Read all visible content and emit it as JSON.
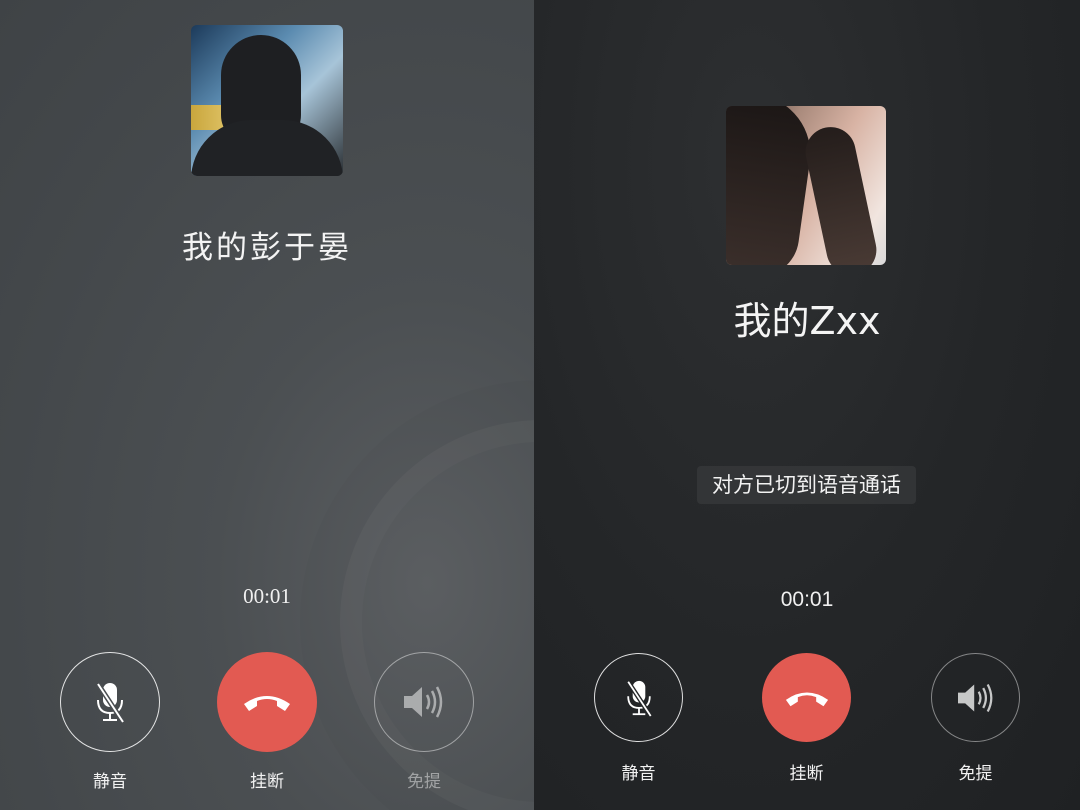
{
  "left_screen": {
    "contact_name": "我的彭于晏",
    "timer": "00:01",
    "controls": {
      "mute_label": "静音",
      "hangup_label": "挂断",
      "speaker_label": "免提"
    }
  },
  "right_screen": {
    "contact_name": "我的Zxx",
    "notice": "对方已切到语音通话",
    "timer": "00:01",
    "controls": {
      "mute_label": "静音",
      "hangup_label": "挂断",
      "speaker_label": "免提"
    }
  },
  "icons": {
    "mute": "mic-muted-icon",
    "hangup": "phone-hangup-icon",
    "speaker": "speaker-icon"
  },
  "colors": {
    "hangup_red": "#e25a52",
    "left_background": "#474b4e",
    "right_background": "#232527"
  }
}
